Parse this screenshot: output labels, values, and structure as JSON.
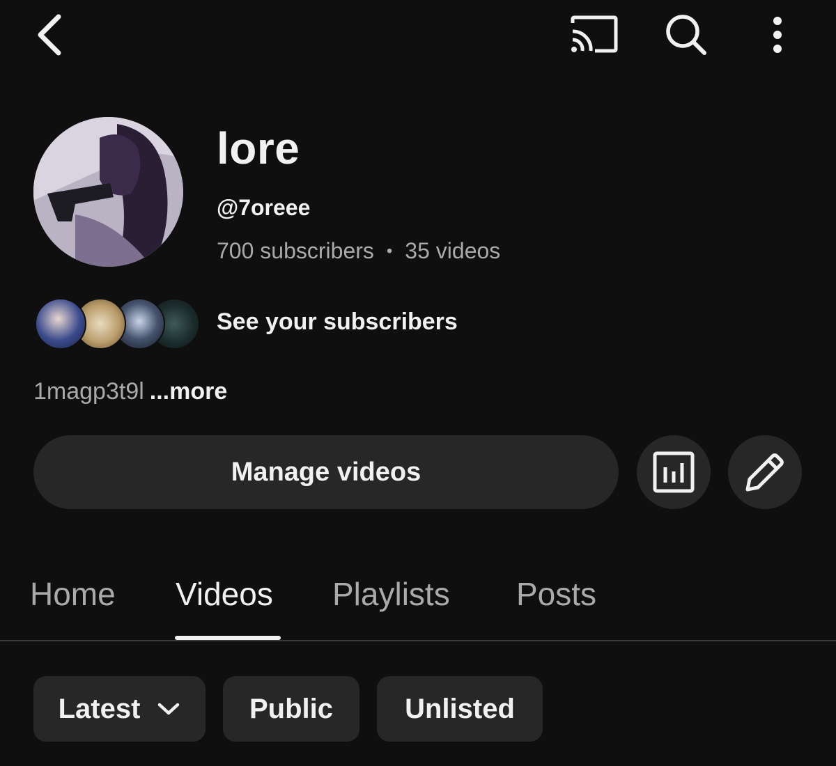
{
  "top_bar": {
    "icons": [
      "back-arrow-icon",
      "cast-icon",
      "search-icon",
      "more-vertical-icon"
    ]
  },
  "channel": {
    "name": "lore",
    "handle": "@7oreee",
    "subscribers": "700 subscribers",
    "separator": "•",
    "videos": "35 videos",
    "see_subscribers": "See your subscribers",
    "description": "1magp3t9l",
    "description_more": "...more"
  },
  "actions": {
    "manage_label": "Manage videos",
    "icons": [
      "analytics-icon",
      "edit-pencil-icon"
    ]
  },
  "tabs": [
    {
      "label": "Home",
      "active": false
    },
    {
      "label": "Videos",
      "active": true
    },
    {
      "label": "Playlists",
      "active": false
    },
    {
      "label": "Posts",
      "active": false
    }
  ],
  "filters": [
    {
      "label": "Latest",
      "has_dropdown": true
    },
    {
      "label": "Public",
      "has_dropdown": false
    },
    {
      "label": "Unlisted",
      "has_dropdown": false
    }
  ],
  "colors": {
    "background": "#0f0f0f",
    "surface": "#272727",
    "text_primary": "#f1f1f1",
    "text_secondary": "#aaaaaa"
  }
}
